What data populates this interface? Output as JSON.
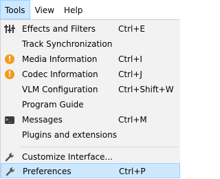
{
  "menubar": {
    "items": [
      {
        "label": "Tools"
      },
      {
        "label": "View"
      },
      {
        "label": "Help"
      }
    ]
  },
  "tools_menu": {
    "items": [
      {
        "label": "Effects and Filters",
        "shortcut": "Ctrl+E",
        "icon": "sliders-icon"
      },
      {
        "label": "Track Synchronization",
        "shortcut": "",
        "icon": ""
      },
      {
        "label": "Media Information",
        "shortcut": "Ctrl+I",
        "icon": "info-icon"
      },
      {
        "label": "Codec Information",
        "shortcut": "Ctrl+J",
        "icon": "info-icon"
      },
      {
        "label": "VLM Configuration",
        "shortcut": "Ctrl+Shift+W",
        "icon": ""
      },
      {
        "label": "Program Guide",
        "shortcut": "",
        "icon": ""
      },
      {
        "label": "Messages",
        "shortcut": "Ctrl+M",
        "icon": "terminal-icon"
      },
      {
        "label": "Plugins and extensions",
        "shortcut": "",
        "icon": ""
      },
      {
        "label": "Customize Interface...",
        "shortcut": "",
        "icon": "wrench-icon"
      },
      {
        "label": "Preferences",
        "shortcut": "Ctrl+P",
        "icon": "wrench-icon"
      }
    ],
    "icon_glyphs": {
      "info": "!",
      "terminal": ">_"
    },
    "highlighted": "Preferences",
    "colors": {
      "highlight": "#cce8ff",
      "highlight_border": "#99d1ff",
      "info_icon": "#f39a1b"
    }
  }
}
